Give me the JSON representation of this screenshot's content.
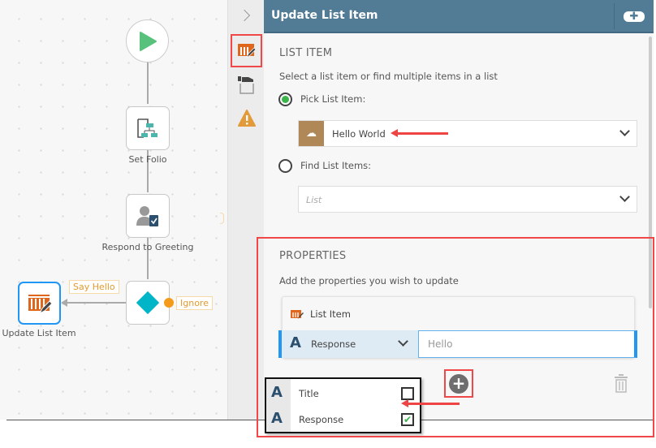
{
  "canvas": {
    "nodes": [
      {
        "label": "",
        "icon": "play-icon"
      },
      {
        "label": "Set Folio",
        "icon": "set-folio-icon"
      },
      {
        "label": "Respond to Greeting",
        "icon": "task-user-icon"
      },
      {
        "label": "",
        "icon": "decision-diamond-icon"
      },
      {
        "label": "Update List Item",
        "icon": "list-edit-icon"
      }
    ],
    "outcomes": {
      "say_hello": "Say Hello",
      "ignore": "Ignore"
    }
  },
  "panel": {
    "title": "Update List Item",
    "list_item": {
      "heading": "LIST ITEM",
      "description": "Select a list item or find multiple items in a list",
      "pick_label": "Pick List Item:",
      "pick_value": "Hello World",
      "find_label": "Find List Items:",
      "find_placeholder": "List",
      "selected_option": "pick"
    },
    "properties": {
      "heading": "PROPERTIES",
      "description": "Add the properties you wish to update",
      "card_title": "List Item",
      "property_name": "Response",
      "property_value": "Hello"
    },
    "popup": {
      "items": [
        {
          "label": "Title",
          "checked": false
        },
        {
          "label": "Response",
          "checked": true
        }
      ]
    }
  },
  "colors": {
    "header": "#527c96",
    "accent_red": "#f04848",
    "brand_orange": "#e0661b",
    "selected_blue": "#2196f3"
  }
}
